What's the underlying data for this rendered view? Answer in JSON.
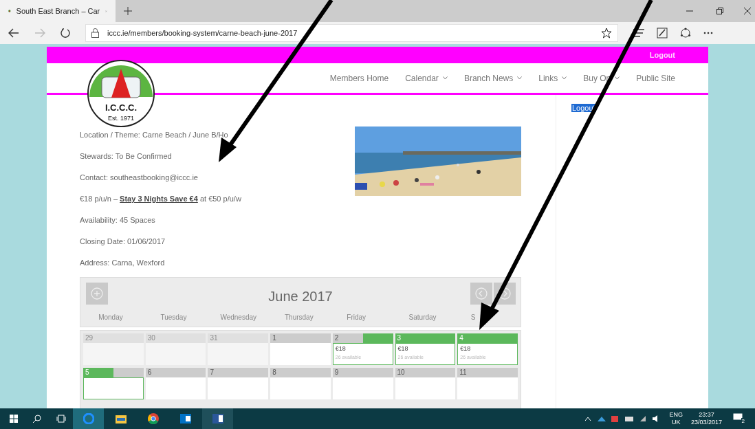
{
  "browser": {
    "tab_title": "South East Branch – Car",
    "url": "iccc.ie/members/booking-system/carne-beach-june-2017"
  },
  "top_bar": {
    "logout": "Logout"
  },
  "logo": {
    "name": "I.C.C.C.",
    "established": "Est. 1971"
  },
  "nav": [
    {
      "label": "Members Home",
      "dropdown": false
    },
    {
      "label": "Calendar",
      "dropdown": true
    },
    {
      "label": "Branch News",
      "dropdown": true
    },
    {
      "label": "Links",
      "dropdown": true
    },
    {
      "label": "Buy On",
      "dropdown": true
    },
    {
      "label": "Public Site",
      "dropdown": false
    }
  ],
  "details": [
    "Location / Theme: Carne Beach / June B/Ho",
    "Stewards:  To Be Confirmed",
    "Contact: southeastbooking@iccc.ie",
    "€18 p/u/n – **Stay 3 Nights Save €4** at €50 p/u/w",
    "Availability: 45 Spaces",
    "Closing Date: 01/06/2017",
    "Address: Carna, Wexford"
  ],
  "sidebar": {
    "link": "Logout",
    "selected": true
  },
  "calendar": {
    "title": "June 2017",
    "weekdays": [
      "Monday",
      "Tuesday",
      "Wednesday",
      "Thursday",
      "Friday",
      "Saturday",
      "S"
    ],
    "weeks": [
      [
        {
          "day": "29",
          "kind": "past"
        },
        {
          "day": "30",
          "kind": "past"
        },
        {
          "day": "31",
          "kind": "past"
        },
        {
          "day": "1",
          "kind": "closed"
        },
        {
          "day": "2",
          "kind": "arrival",
          "price": "€18",
          "availability": "26 available"
        },
        {
          "day": "3",
          "kind": "available",
          "price": "€18",
          "availability": "26 available"
        },
        {
          "day": "4",
          "kind": "available",
          "price": "€18",
          "availability": "26 available"
        }
      ],
      [
        {
          "day": "5",
          "kind": "departure"
        },
        {
          "day": "6",
          "kind": "closed"
        },
        {
          "day": "7",
          "kind": "closed"
        },
        {
          "day": "8",
          "kind": "closed"
        },
        {
          "day": "9",
          "kind": "closed"
        },
        {
          "day": "10",
          "kind": "closed"
        },
        {
          "day": "11",
          "kind": "closed"
        }
      ]
    ]
  },
  "taskbar": {
    "language": "ENG",
    "region": "UK",
    "time": "23:37",
    "date": "23/03/2017",
    "notifications": "2"
  }
}
